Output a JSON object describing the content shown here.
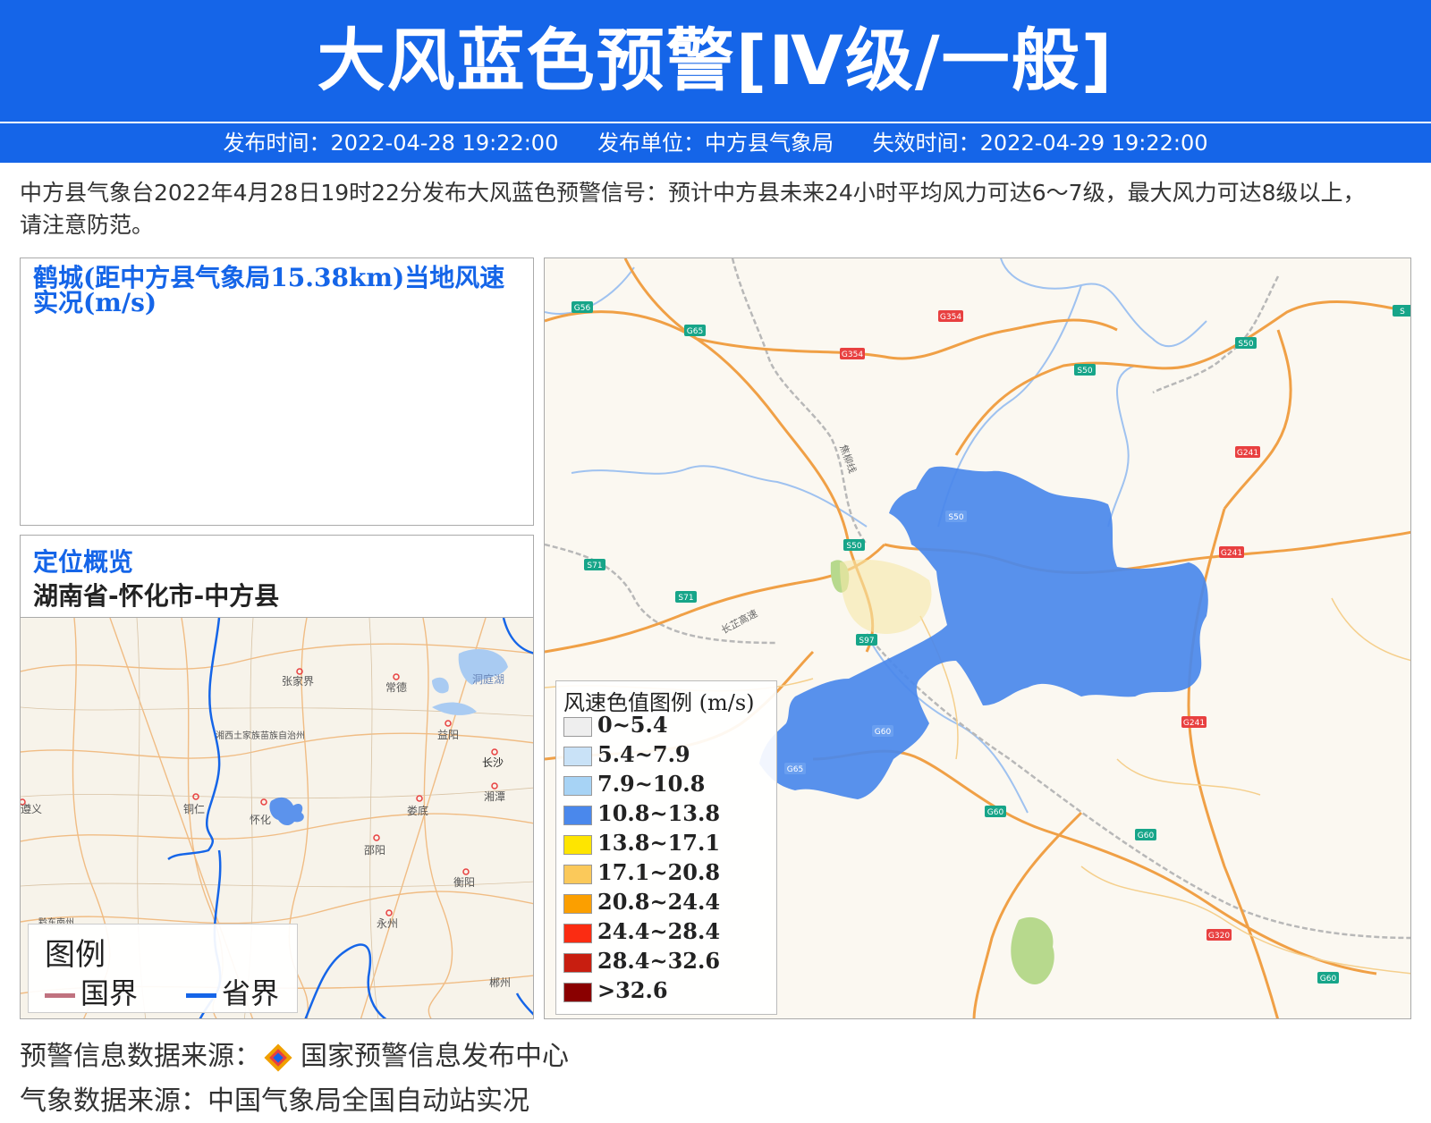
{
  "header": {
    "title": "大风蓝色预警[Ⅳ级/一般]",
    "publish_time": "发布时间：2022-04-28 19:22:00",
    "publish_unit": "发布单位：中方县气象局",
    "expire_time": "失效时间：2022-04-29 19:22:00"
  },
  "description": "中方县气象台2022年4月28日19时22分发布大风蓝色预警信号：预计中方县未来24小时平均风力可达6～7级，最大风力可达8级以上，请注意防范。",
  "station": {
    "title": "鹤城(距中方县气象局15.38km)当地风速实况(m/s)"
  },
  "location": {
    "title": "定位概览",
    "path": "湖南省-怀化市-中方县",
    "map_labels": {
      "zhangjiajie": "张家界",
      "changde": "常德",
      "dongtinghu": "洞庭湖",
      "xiangxi": "湘西土家族苗族自治州",
      "yiyang": "益阳",
      "changsha": "长沙",
      "tongren": "铜仁",
      "xiangtan": "湘潭",
      "zunyi": "遵义",
      "huaihua": "怀化",
      "loudi": "娄底",
      "shaoyang": "邵阳",
      "hengyang": "衡阳",
      "yongzhou": "永州",
      "chenzhou": "郴州",
      "qiandongnan": "黔东南州"
    },
    "legend": {
      "title": "图例",
      "items": [
        {
          "label": "国界",
          "color": "#c0727f"
        },
        {
          "label": "省界",
          "color": "#1565e8"
        }
      ]
    }
  },
  "bigmap": {
    "road_labels": {
      "g56": "G56",
      "g65a": "G65",
      "g354a": "G354",
      "g354b": "G354",
      "s50a": "S50",
      "s50b": "S50",
      "s50c": "S50",
      "s50d": "S50",
      "g241a": "G241",
      "g241b": "G241",
      "g241c": "G241",
      "s71a": "S71",
      "s71b": "S71",
      "s97": "S97",
      "g60a": "G60",
      "g60b": "G60",
      "g60c": "G60",
      "g60d": "G60",
      "g65b": "G65",
      "g320": "G320",
      "railway1": "长芷高速",
      "railway2": "焦柳线"
    },
    "alert_color": "#4a88ec"
  },
  "wind_legend": {
    "title": "风速色值图例 (m/s)",
    "items": [
      {
        "label": "0~5.4",
        "color": "#eeeeee"
      },
      {
        "label": "5.4~7.9",
        "color": "#c9e2f7"
      },
      {
        "label": "7.9~10.8",
        "color": "#a7d3f5"
      },
      {
        "label": "10.8~13.8",
        "color": "#4a88ec"
      },
      {
        "label": "13.8~17.1",
        "color": "#fee500"
      },
      {
        "label": "17.1~20.8",
        "color": "#fbc95a"
      },
      {
        "label": "20.8~24.4",
        "color": "#fb9f00"
      },
      {
        "label": "24.4~28.4",
        "color": "#fb2c12"
      },
      {
        "label": "28.4~32.6",
        "color": "#c81e10"
      },
      {
        "label": ">32.6",
        "color": "#8a0000"
      }
    ]
  },
  "footer": {
    "warning_source_label": "预警信息数据来源：",
    "warning_source_name": "国家预警信息发布中心",
    "weather_source": "气象数据来源：中国气象局全国自动站实况"
  }
}
